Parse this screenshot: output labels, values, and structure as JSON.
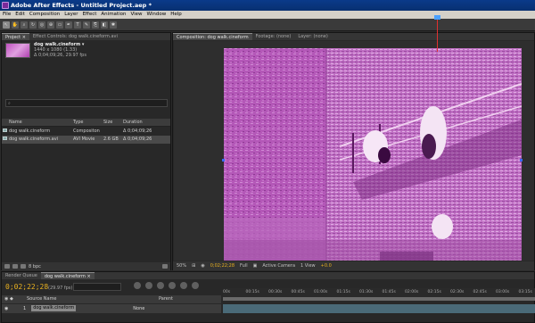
{
  "title_bar": {
    "text": "Adobe After Effects - Untitled Project.aep *"
  },
  "menu": [
    "File",
    "Edit",
    "Composition",
    "Layer",
    "Effect",
    "Animation",
    "View",
    "Window",
    "Help"
  ],
  "project_panel": {
    "tabs": [
      "Project ×",
      "Effect Controls: dog walk.cineform.avi"
    ],
    "item_name": "dog walk.cineform ▾",
    "item_details": [
      "1440 x 1080 (1.33)",
      "Δ 0;04;09;26, 29.97 fps"
    ],
    "columns": {
      "name": "Name",
      "type": "Type",
      "size": "Size",
      "duration": "Duration"
    },
    "rows": [
      {
        "name": "dog walk.cineform",
        "type": "Compositon",
        "size": "",
        "duration": "Δ 0;04;09;26"
      },
      {
        "name": "dog walk.cineform.avi",
        "type": "AVI Movie",
        "size": "2.6 GB",
        "duration": "Δ 0;04;09;26"
      }
    ],
    "footer_bpc": "8 bpc"
  },
  "comp_panel": {
    "tabs": [
      "Composition: dog walk.cineform",
      "Footage: (none)",
      "Layer: (none)"
    ],
    "zoom": "50%",
    "timecode": "0;02;22;28",
    "resolution": "Full",
    "camera": "Active Camera",
    "views": "1 View",
    "exposure": "+0.0"
  },
  "timeline": {
    "tabs": [
      "Render Queue",
      "dog walk.cineform ×"
    ],
    "current_time": "0;02;22;28",
    "fps": "(29.97 fps)",
    "header_source": "Source Name",
    "header_parent": "Parent",
    "layer_index": "1",
    "layer_name": "dog walk.cineform",
    "parent_value": "None",
    "ruler_ticks": [
      "00s",
      "00:15s",
      "00:30s",
      "00:45s",
      "01:00s",
      "01:15s",
      "01:30s",
      "01:45s",
      "02:00s",
      "02:15s",
      "02:30s",
      "02:45s",
      "03:00s",
      "03:15s"
    ]
  }
}
